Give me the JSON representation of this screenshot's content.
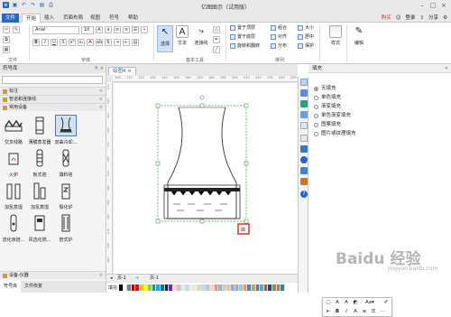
{
  "window": {
    "title": "亿图图示（试用版）"
  },
  "menu": {
    "tabs": [
      "文件",
      "开始",
      "插入",
      "页面布局",
      "视图",
      "符号",
      "帮助"
    ],
    "active_index": 1
  },
  "account": {
    "buy": "购买",
    "login": "登录",
    "share": "分享"
  },
  "ribbon": {
    "font_name": "Arial",
    "font_size": "10",
    "groups": [
      "文件",
      "字体",
      "基本工具",
      "排列"
    ],
    "tools": {
      "select": "选择",
      "text": "文本",
      "connector": "连接线"
    },
    "arrange": [
      "置于顶层",
      "置于底层",
      "旋转和翻转",
      "组合",
      "对齐",
      "分布",
      "大小",
      "居中",
      "保护"
    ],
    "style": "样式",
    "edit": "编辑"
  },
  "library": {
    "title": "符号库",
    "sections": [
      "标注",
      "管道和连接线",
      "常用设备",
      "设备-仪器"
    ],
    "shapes": [
      "交叉线路",
      "薄膜蒸发器",
      "双曲冷却...",
      "火炉",
      "板式塔",
      "填料塔",
      "加氢蒸馏",
      "加氢蒸馏",
      "裂化炉",
      "流化床焙...",
      "风选化燃...",
      "管式炉"
    ],
    "bottom_tabs": [
      "符号库",
      "文件恢复"
    ]
  },
  "document": {
    "tab": "绘图4",
    "page": "页-1",
    "page2": "页-1",
    "fill_label": "填充",
    "ruler_h": [
      "100",
      "110",
      "120",
      "130",
      "140",
      "150",
      "160",
      "170",
      "180",
      "190",
      "200",
      "210",
      "220",
      "230",
      "240",
      "250"
    ],
    "ruler_v": [
      "110",
      "120",
      "130",
      "140",
      "150",
      "160",
      "170",
      "180",
      "190",
      "200",
      "210",
      "220",
      "230"
    ]
  },
  "fill_panel": {
    "title": "填充",
    "options": [
      "无填充",
      "单色填充",
      "渐变填充",
      "单色渐变填充",
      "图案填充",
      "图片或纹理填充"
    ],
    "selected": 0
  },
  "watermark": {
    "main": "Baidu 经验",
    "sub": "jingyan.baidu.com"
  },
  "colors": {
    "accent": "#2a64c5",
    "highlight": "#e03030",
    "palette": [
      "#000000",
      "#ffffff",
      "#7f7f7f",
      "#c00000",
      "#ff0000",
      "#ffc000",
      "#ffff00",
      "#92d050",
      "#00b050",
      "#00b0f0",
      "#0070c0",
      "#002060",
      "#7030a0",
      "#f2dcdb",
      "#e6b9b8",
      "#dbeef4",
      "#c6d9f1",
      "#ebf1de",
      "#fde9d9",
      "#ddd9c4",
      "#b7dee8",
      "#ccc0da",
      "#fcd5b4",
      "#d99694",
      "#95b3d7",
      "#c3d69b",
      "#fabf8f",
      "#8db3e2",
      "#b2a1c7",
      "#93cddd",
      "#f79646",
      "#4f81bd",
      "#9bbb59",
      "#8064a2",
      "#4bacc6",
      "#c0504d",
      "#1f497d",
      "#938953",
      "#e36c09",
      "#31859b"
    ]
  }
}
